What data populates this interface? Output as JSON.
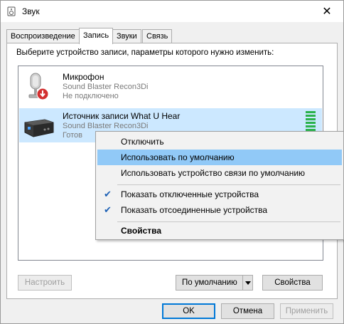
{
  "window": {
    "title": "Звук",
    "close_glyph": "✕"
  },
  "tabs": [
    {
      "label": "Воспроизведение",
      "active": false
    },
    {
      "label": "Запись",
      "active": true
    },
    {
      "label": "Звуки",
      "active": false
    },
    {
      "label": "Связь",
      "active": false
    }
  ],
  "panel": {
    "instruction": "Выберите устройство записи, параметры которого нужно изменить:"
  },
  "devices": [
    {
      "name": "Микрофон",
      "driver": "Sound Blaster Recon3Di",
      "status": "Не подключено",
      "icon": "microphone-icon",
      "selected": false
    },
    {
      "name": "Источник записи What U Hear",
      "driver": "Sound Blaster Recon3Di",
      "status": "Готов",
      "icon": "sound-card-icon",
      "selected": true
    }
  ],
  "context_menu": {
    "items": [
      {
        "label": "Отключить",
        "checked": false,
        "highlighted": false,
        "bold": false
      },
      {
        "label": "Использовать по умолчанию",
        "checked": false,
        "highlighted": true,
        "bold": false
      },
      {
        "label": "Использовать устройство связи по умолчанию",
        "checked": false,
        "highlighted": false,
        "bold": false
      },
      {
        "label": "Показать отключенные устройства",
        "checked": true,
        "highlighted": false,
        "bold": false
      },
      {
        "label": "Показать отсоединенные устройства",
        "checked": true,
        "highlighted": false,
        "bold": false
      },
      {
        "label": "Свойства",
        "checked": false,
        "highlighted": false,
        "bold": true
      }
    ]
  },
  "panel_buttons": {
    "configure": "Настроить",
    "default": "По умолчанию",
    "properties": "Свойства"
  },
  "dialog_buttons": {
    "ok": "OK",
    "cancel": "Отмена",
    "apply": "Применить"
  },
  "colors": {
    "selection": "#cce8ff",
    "menu_highlight": "#91c9f7",
    "level_meter": "#2bb24c",
    "primary_border": "#0078d7",
    "unplugged_badge": "#d32f2f"
  }
}
